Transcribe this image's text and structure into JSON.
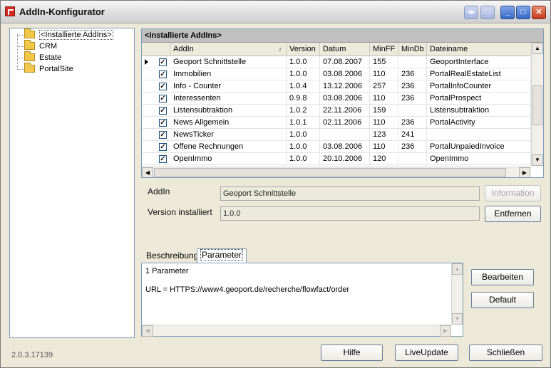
{
  "window": {
    "title": "AddIn-Konfigurator"
  },
  "tree": {
    "items": [
      {
        "label": "<Installierte AddIns>",
        "selected": true
      },
      {
        "label": "CRM"
      },
      {
        "label": "Estate"
      },
      {
        "label": "PortalSite"
      }
    ]
  },
  "grid": {
    "caption": "<Installierte AddIns>",
    "columns": [
      "AddIn",
      "Version",
      "Datum",
      "MinFF",
      "MinDb",
      "Dateiname"
    ],
    "rows": [
      {
        "checked": true,
        "addin": "Geoport Schnittstelle",
        "version": "1.0.0",
        "datum": "07.08.2007",
        "minff": "155",
        "mindb": "",
        "dateiname": "GeoportInterface",
        "current": true
      },
      {
        "checked": true,
        "addin": "Immobilien",
        "version": "1.0.0",
        "datum": "03.08.2006",
        "minff": "110",
        "mindb": "236",
        "dateiname": "PortalRealEstateList"
      },
      {
        "checked": true,
        "addin": "Info - Counter",
        "version": "1.0.4",
        "datum": "13.12.2006",
        "minff": "257",
        "mindb": "236",
        "dateiname": "PortalInfoCounter"
      },
      {
        "checked": true,
        "addin": "Interessenten",
        "version": "0.9.8",
        "datum": "03.08.2006",
        "minff": "110",
        "mindb": "236",
        "dateiname": "PortalProspect"
      },
      {
        "checked": true,
        "addin": "Listensubtraktion",
        "version": "1.0.2",
        "datum": "22.11.2006",
        "minff": "159",
        "mindb": "",
        "dateiname": "Listensubtraktion"
      },
      {
        "checked": true,
        "addin": "News Allgemein",
        "version": "1.0.1",
        "datum": "02.11.2006",
        "minff": "110",
        "mindb": "236",
        "dateiname": "PortalActivity"
      },
      {
        "checked": true,
        "addin": "NewsTicker",
        "version": "1.0.0",
        "datum": "",
        "minff": "123",
        "mindb": "241",
        "dateiname": ""
      },
      {
        "checked": true,
        "addin": "Offene Rechnungen",
        "version": "1.0.0",
        "datum": "03.08.2006",
        "minff": "110",
        "mindb": "236",
        "dateiname": "PortalUnpaiedInvoice"
      },
      {
        "checked": true,
        "addin": "OpenImmo",
        "version": "1.0.0",
        "datum": "20.10.2006",
        "minff": "120",
        "mindb": "",
        "dateiname": "OpenImmo"
      }
    ]
  },
  "details": {
    "addin_label": "AddIn",
    "addin_value": "Geoport Schnittstelle",
    "version_label": "Version installiert",
    "version_value": "1.0.0",
    "information_button": "Information",
    "remove_button": "Entfernen"
  },
  "tabs": {
    "items": [
      "Beschreibung",
      "Parameter"
    ],
    "active": "Parameter"
  },
  "parameters": {
    "count_text": "1 Parameter",
    "line": "URL = HTTPS://www4.geoport.de/recherche/flowfact/order",
    "edit_button": "Bearbeiten",
    "default_button": "Default"
  },
  "footer": {
    "version": "2.0.3.17139",
    "help_button": "Hilfe",
    "liveupdate_button": "LiveUpdate",
    "close_button": "Schließen"
  }
}
